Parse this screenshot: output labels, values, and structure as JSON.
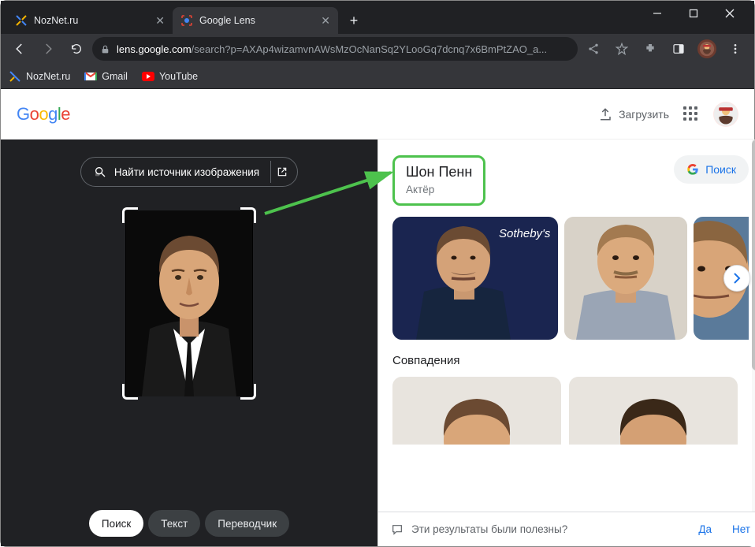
{
  "browser": {
    "tabs": [
      {
        "label": "NozNet.ru"
      },
      {
        "label": "Google Lens"
      }
    ],
    "url_domain": "lens.google.com",
    "url_path": "/search?p=AXAp4wizamvnAWsMzOcNanSq2YLooGq7dcnq7x6BmPtZAO_a...",
    "bookmarks": [
      {
        "label": "NozNet.ru"
      },
      {
        "label": "Gmail"
      },
      {
        "label": "YouTube"
      }
    ]
  },
  "header": {
    "upload_label": "Загрузить"
  },
  "left_panel": {
    "find_source_label": "Найти источник изображения",
    "modes": {
      "search": "Поиск",
      "text": "Текст",
      "translate": "Переводчик"
    }
  },
  "results": {
    "kg": {
      "name": "Шон Пенн",
      "subtitle": "Актёр"
    },
    "search_button": "Поиск",
    "matches_title": "Совпадения",
    "feedback": {
      "question": "Эти результаты были полезны?",
      "yes": "Да",
      "no": "Нет"
    }
  }
}
